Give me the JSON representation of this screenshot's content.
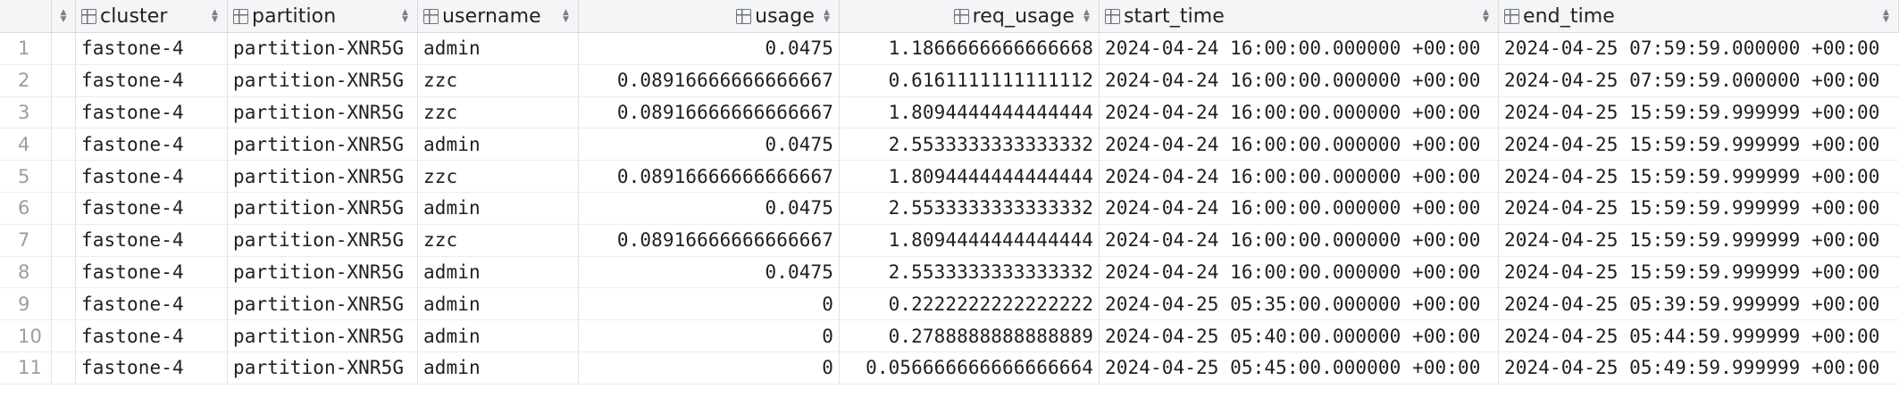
{
  "columns": {
    "cluster": "cluster",
    "partition": "partition",
    "username": "username",
    "usage": "usage",
    "req_usage": "req_usage",
    "start_time": "start_time",
    "end_time": "end_time"
  },
  "rows": [
    {
      "num": "1",
      "cluster": "fastone-4",
      "partition": "partition-XNR5G",
      "username": "admin",
      "usage": "0.0475",
      "req_usage": "1.1866666666666668",
      "start_time": "2024-04-24 16:00:00.000000 +00:00",
      "end_time": "2024-04-25 07:59:59.000000 +00:00"
    },
    {
      "num": "2",
      "cluster": "fastone-4",
      "partition": "partition-XNR5G",
      "username": "zzc",
      "usage": "0.08916666666666667",
      "req_usage": "0.6161111111111112",
      "start_time": "2024-04-24 16:00:00.000000 +00:00",
      "end_time": "2024-04-25 07:59:59.000000 +00:00"
    },
    {
      "num": "3",
      "cluster": "fastone-4",
      "partition": "partition-XNR5G",
      "username": "zzc",
      "usage": "0.08916666666666667",
      "req_usage": "1.8094444444444444",
      "start_time": "2024-04-24 16:00:00.000000 +00:00",
      "end_time": "2024-04-25 15:59:59.999999 +00:00"
    },
    {
      "num": "4",
      "cluster": "fastone-4",
      "partition": "partition-XNR5G",
      "username": "admin",
      "usage": "0.0475",
      "req_usage": "2.5533333333333332",
      "start_time": "2024-04-24 16:00:00.000000 +00:00",
      "end_time": "2024-04-25 15:59:59.999999 +00:00"
    },
    {
      "num": "5",
      "cluster": "fastone-4",
      "partition": "partition-XNR5G",
      "username": "zzc",
      "usage": "0.08916666666666667",
      "req_usage": "1.8094444444444444",
      "start_time": "2024-04-24 16:00:00.000000 +00:00",
      "end_time": "2024-04-25 15:59:59.999999 +00:00"
    },
    {
      "num": "6",
      "cluster": "fastone-4",
      "partition": "partition-XNR5G",
      "username": "admin",
      "usage": "0.0475",
      "req_usage": "2.5533333333333332",
      "start_time": "2024-04-24 16:00:00.000000 +00:00",
      "end_time": "2024-04-25 15:59:59.999999 +00:00"
    },
    {
      "num": "7",
      "cluster": "fastone-4",
      "partition": "partition-XNR5G",
      "username": "zzc",
      "usage": "0.08916666666666667",
      "req_usage": "1.8094444444444444",
      "start_time": "2024-04-24 16:00:00.000000 +00:00",
      "end_time": "2024-04-25 15:59:59.999999 +00:00"
    },
    {
      "num": "8",
      "cluster": "fastone-4",
      "partition": "partition-XNR5G",
      "username": "admin",
      "usage": "0.0475",
      "req_usage": "2.5533333333333332",
      "start_time": "2024-04-24 16:00:00.000000 +00:00",
      "end_time": "2024-04-25 15:59:59.999999 +00:00"
    },
    {
      "num": "9",
      "cluster": "fastone-4",
      "partition": "partition-XNR5G",
      "username": "admin",
      "usage": "0",
      "req_usage": "0.2222222222222222",
      "start_time": "2024-04-25 05:35:00.000000 +00:00",
      "end_time": "2024-04-25 05:39:59.999999 +00:00"
    },
    {
      "num": "10",
      "cluster": "fastone-4",
      "partition": "partition-XNR5G",
      "username": "admin",
      "usage": "0",
      "req_usage": "0.2788888888888889",
      "start_time": "2024-04-25 05:40:00.000000 +00:00",
      "end_time": "2024-04-25 05:44:59.999999 +00:00"
    },
    {
      "num": "11",
      "cluster": "fastone-4",
      "partition": "partition-XNR5G",
      "username": "admin",
      "usage": "0",
      "req_usage": "0.056666666666666664",
      "start_time": "2024-04-25 05:45:00.000000 +00:00",
      "end_time": "2024-04-25 05:49:59.999999 +00:00"
    }
  ],
  "icons": {
    "column": "table-column-icon",
    "sort": "sort-arrows-icon"
  }
}
